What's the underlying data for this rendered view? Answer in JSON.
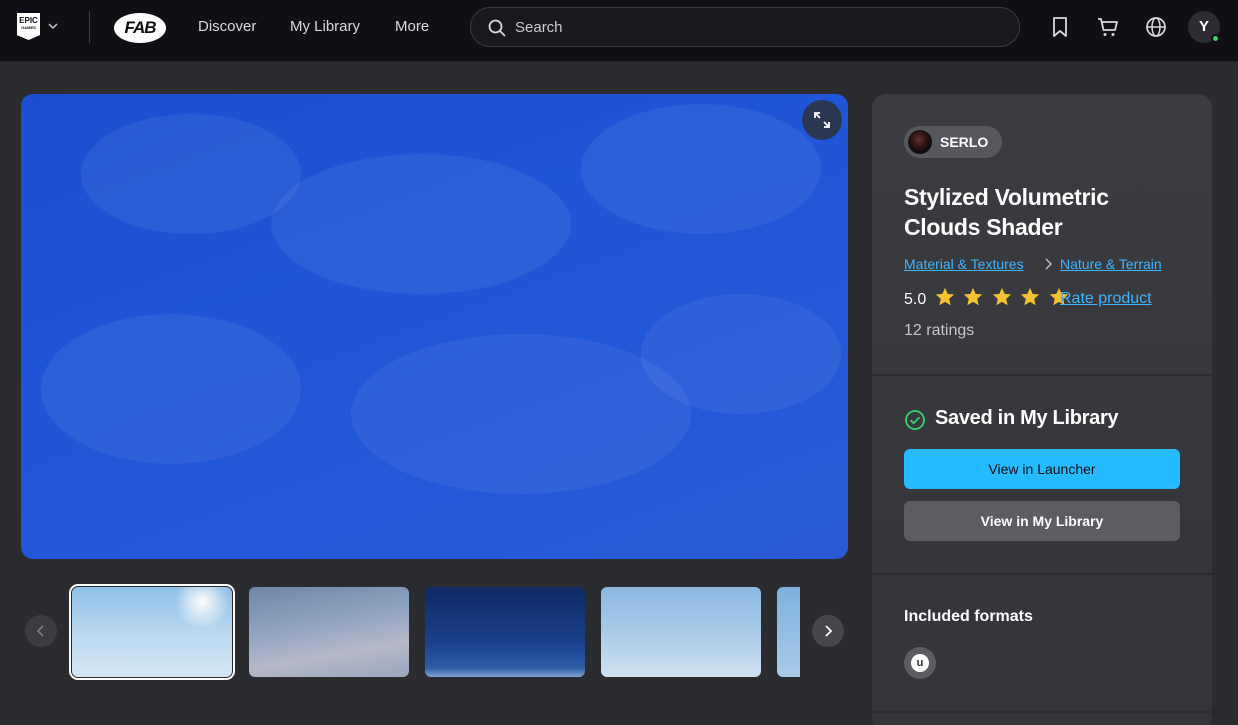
{
  "nav": {
    "epic_logo_text": "EPIC",
    "epic_logo_sub": "GAMES",
    "fab_logo_text": "FAB",
    "links": [
      "Discover",
      "My Library",
      "More"
    ],
    "search_placeholder": "Search",
    "avatar_initial": "Y",
    "icons": [
      "bookmark-icon",
      "cart-icon",
      "globe-icon"
    ]
  },
  "gallery": {
    "thumbnail_count": 5,
    "active_index": 0
  },
  "product": {
    "seller": "SERLO",
    "title": "Stylized Volumetric Clouds Shader",
    "breadcrumb": [
      "Material & Textures",
      "Nature & Terrain"
    ],
    "rating": "5.0",
    "stars": 5,
    "rate_link": "Rate product",
    "ratings_count": "12 ratings"
  },
  "library": {
    "status": "Saved in My Library",
    "primary_button": "View in Launcher",
    "secondary_button": "View in My Library"
  },
  "formats": {
    "title": "Included formats",
    "items": [
      "unreal-engine-icon"
    ]
  },
  "colors": {
    "accent": "#26bbff",
    "link": "#3eb5ff",
    "star": "#f7c232",
    "success": "#3ad16b"
  }
}
